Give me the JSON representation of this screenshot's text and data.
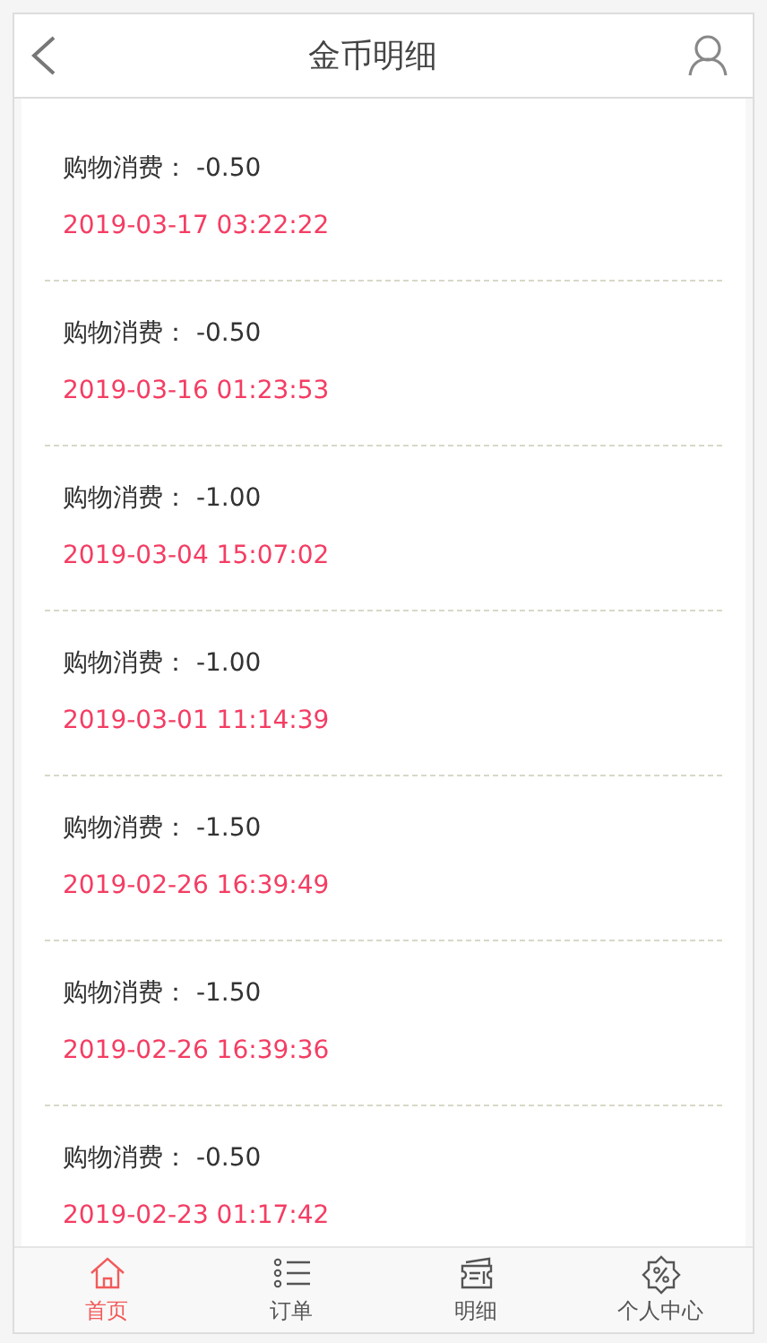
{
  "header": {
    "title": "金币明细"
  },
  "records": [
    {
      "label": "购物消费： -0.50",
      "time": "2019-03-17 03:22:22"
    },
    {
      "label": "购物消费： -0.50",
      "time": "2019-03-16 01:23:53"
    },
    {
      "label": "购物消费： -1.00",
      "time": "2019-03-04 15:07:02"
    },
    {
      "label": "购物消费： -1.00",
      "time": "2019-03-01 11:14:39"
    },
    {
      "label": "购物消费： -1.50",
      "time": "2019-02-26 16:39:49"
    },
    {
      "label": "购物消费： -1.50",
      "time": "2019-02-26 16:39:36"
    },
    {
      "label": "购物消费： -0.50",
      "time": "2019-02-23 01:17:42"
    }
  ],
  "tabbar": [
    {
      "kind": "home",
      "label": "首页",
      "selected": true
    },
    {
      "kind": "list",
      "label": "订单",
      "selected": false
    },
    {
      "kind": "ticket",
      "label": "明细",
      "selected": false
    },
    {
      "kind": "badge",
      "label": "个人中心",
      "selected": false
    }
  ]
}
